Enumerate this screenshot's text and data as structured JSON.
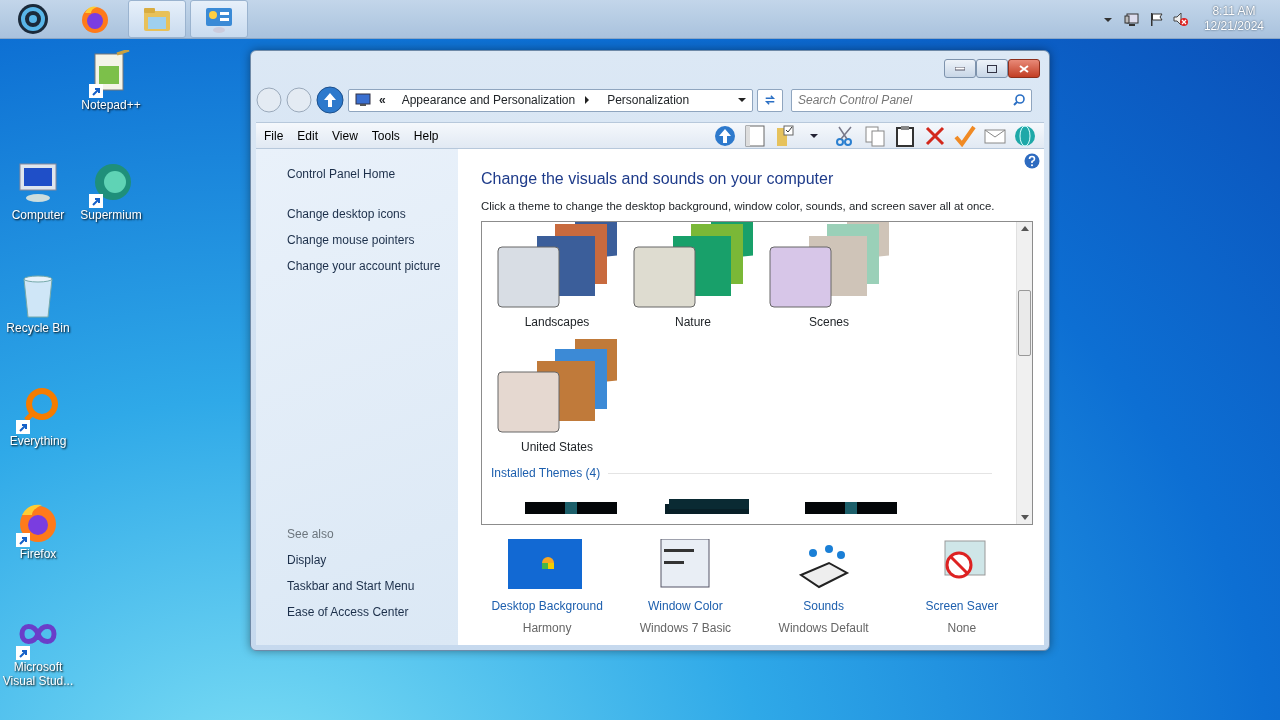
{
  "taskbar": {
    "items": [
      {
        "kind": "start",
        "open": false
      },
      {
        "kind": "firefox",
        "open": false
      },
      {
        "kind": "folder",
        "open": true
      },
      {
        "kind": "control-panel",
        "open": true
      }
    ],
    "tray": {
      "icons": [
        {
          "kind": "caret"
        },
        {
          "kind": "network"
        },
        {
          "kind": "flag"
        },
        {
          "kind": "muted-speaker"
        }
      ],
      "time": "8:11 AM",
      "date": "12/21/2024"
    }
  },
  "desktop_icons": [
    {
      "label": "Notepad++",
      "kind": "notepad",
      "shortcut": true
    },
    {
      "label": "Computer",
      "kind": "computer",
      "shortcut": false
    },
    {
      "label": "Supermium",
      "kind": "browser",
      "shortcut": true
    },
    {
      "label": "Recycle Bin",
      "kind": "bin",
      "shortcut": false
    },
    {
      "label": "Everything",
      "kind": "search-ring",
      "shortcut": true
    },
    {
      "label": "Firefox",
      "kind": "firefox",
      "shortcut": true
    },
    {
      "label": "Microsoft Visual Stud...",
      "kind": "infinity",
      "shortcut": true
    }
  ],
  "window": {
    "address": {
      "prefix": "«",
      "path": [
        "Appearance and Personalization",
        "Personalization"
      ]
    },
    "search": {
      "placeholder": "Search Control Panel"
    },
    "menu": [
      "File",
      "Edit",
      "View",
      "Tools",
      "Help"
    ],
    "sidebar": {
      "home": "Control Panel Home",
      "links": [
        "Change desktop icons",
        "Change mouse pointers",
        "Change your account picture"
      ],
      "see_also": "See also",
      "see_also_links": [
        "Display",
        "Taskbar and Start Menu",
        "Ease of Access Center"
      ]
    },
    "content": {
      "heading": "Change the visuals and sounds on your computer",
      "description": "Click a theme to change the desktop background, window color, sounds, and screen saver all at once.",
      "themes": [
        {
          "name": "Landscapes",
          "kind": "landscapes"
        },
        {
          "name": "Nature",
          "kind": "nature"
        },
        {
          "name": "Scenes",
          "kind": "scenes"
        },
        {
          "name": "United States",
          "kind": "usa"
        }
      ],
      "installed_heading": "Installed Themes (4)",
      "installed_themes": [
        {
          "kind": "dark"
        },
        {
          "kind": "dark-stack"
        },
        {
          "kind": "dark"
        }
      ],
      "settings": [
        {
          "label": "Desktop Background",
          "value": "Harmony",
          "kind": "background"
        },
        {
          "label": "Window Color",
          "value": "Windows 7 Basic",
          "kind": "window-color"
        },
        {
          "label": "Sounds",
          "value": "Windows Default",
          "kind": "sounds"
        },
        {
          "label": "Screen Saver",
          "value": "None",
          "kind": "screen-saver"
        }
      ]
    }
  }
}
